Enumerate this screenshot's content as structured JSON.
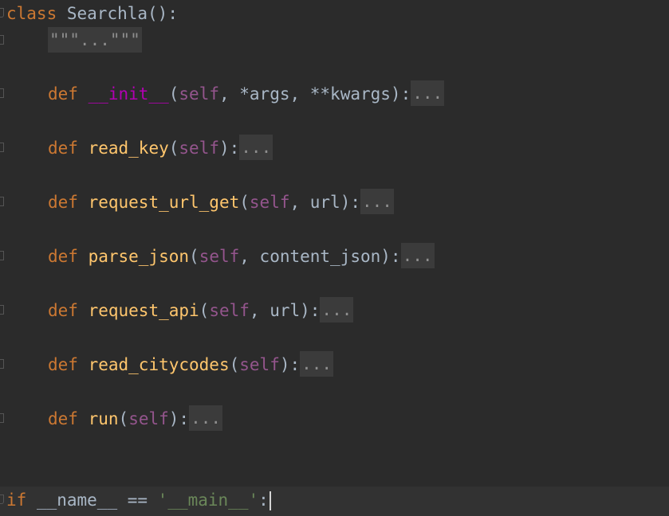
{
  "editor": {
    "lines": {
      "class_def": {
        "kw": "class",
        "name": "Searchla",
        "rest": "():"
      },
      "docstring": {
        "folded": "\"\"\"...\"\"\""
      },
      "init": {
        "kw": "def",
        "name": "__init__",
        "open": "(",
        "self": "self",
        "params": ", *args, **kwargs",
        "close": "):",
        "folded": "..."
      },
      "read_key": {
        "kw": "def",
        "name": "read_key",
        "open": "(",
        "self": "self",
        "params": "",
        "close": "):",
        "folded": "..."
      },
      "request_url_get": {
        "kw": "def",
        "name": "request_url_get",
        "open": "(",
        "self": "self",
        "params": ", url",
        "close": "):",
        "folded": "..."
      },
      "parse_json": {
        "kw": "def",
        "name": "parse_json",
        "open": "(",
        "self": "self",
        "params": ", content_json",
        "close": "):",
        "folded": "..."
      },
      "request_api": {
        "kw": "def",
        "name": "request_api",
        "open": "(",
        "self": "self",
        "params": ", url",
        "close": "):",
        "folded": "..."
      },
      "read_citycodes": {
        "kw": "def",
        "name": "read_citycodes",
        "open": "(",
        "self": "self",
        "params": "",
        "close": "):",
        "folded": "..."
      },
      "run": {
        "kw": "def",
        "name": "run",
        "open": "(",
        "self": "self",
        "params": "",
        "close": "):",
        "folded": "..."
      },
      "main_guard": {
        "kw": "if",
        "name_var": " __name__ == ",
        "str": "'__main__'",
        "colon": ":"
      }
    },
    "colors": {
      "background": "#2b2b2b",
      "keyword": "#cc7832",
      "function": "#ffc66d",
      "magic": "#b200b2",
      "self": "#94558d",
      "string": "#6a8759",
      "text": "#a9b7c6"
    }
  }
}
